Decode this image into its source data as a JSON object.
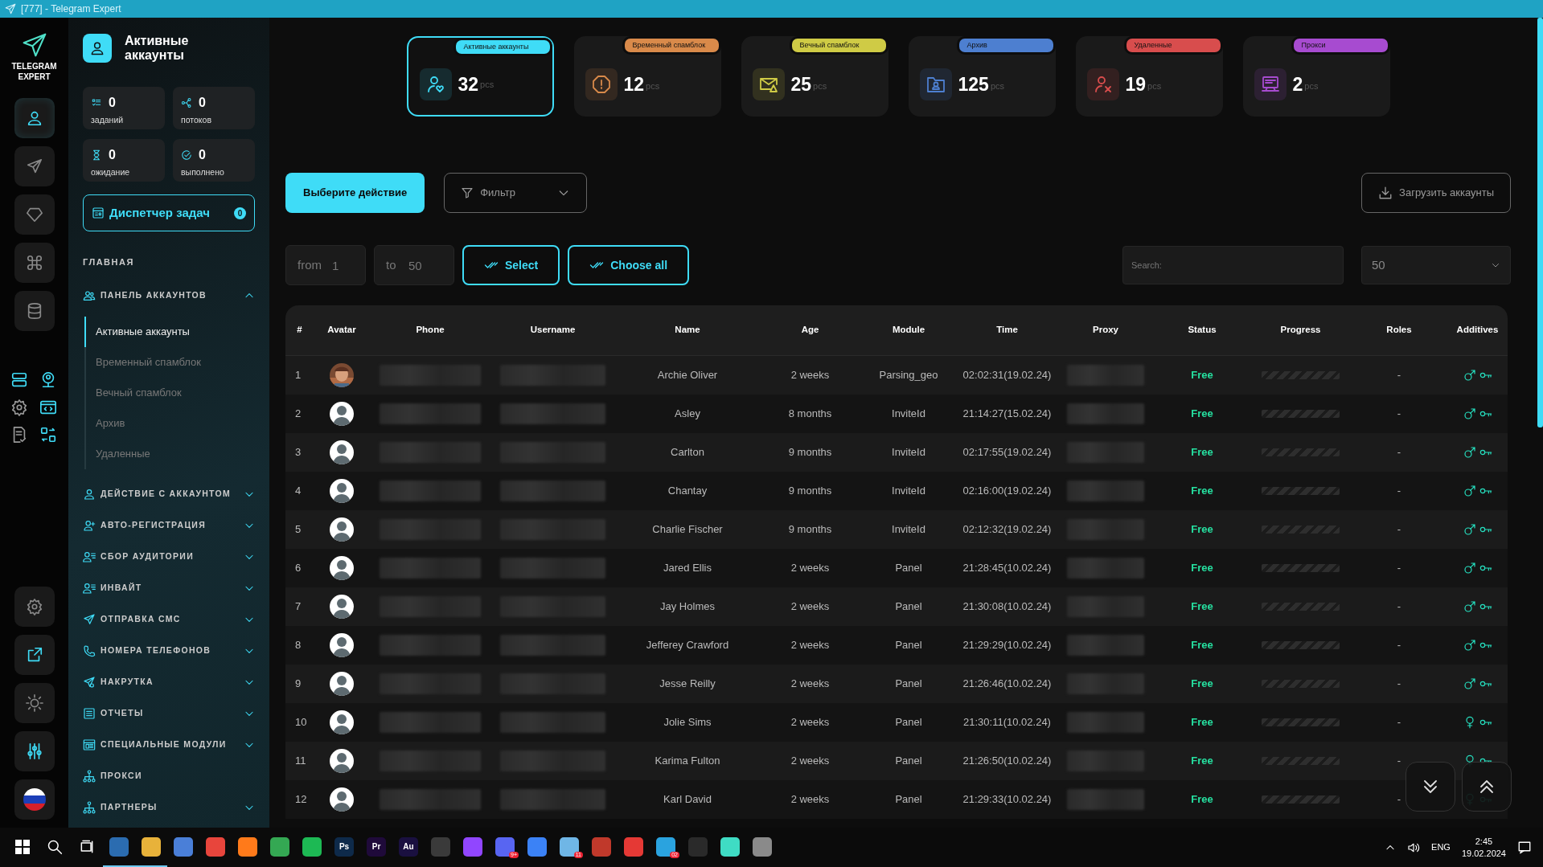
{
  "window": {
    "title": "[777] - Telegram Expert"
  },
  "brand": {
    "name": "TELEGRAM EXPERT"
  },
  "rail": {
    "top": [
      {
        "selected": true
      },
      {
        "selected": false
      },
      {
        "selected": false
      },
      {
        "selected": false
      },
      {
        "selected": false
      }
    ]
  },
  "sidebar": {
    "title": "Активные аккаунты",
    "stats": [
      {
        "value": "0",
        "label": "заданий"
      },
      {
        "value": "0",
        "label": "потоков"
      },
      {
        "value": "0",
        "label": "ожидание"
      },
      {
        "value": "0",
        "label": "выполнено"
      }
    ],
    "task_manager": {
      "label": "Диспетчер задач",
      "count": "0"
    },
    "section": "ГЛАВНАЯ",
    "groups": [
      {
        "label": "ПАНЕЛЬ АККАУНТОВ",
        "expandable": true,
        "expanded": true,
        "children": [
          {
            "label": "Активные аккаунты",
            "selected": true
          },
          {
            "label": "Временный спамблок",
            "selected": false
          },
          {
            "label": "Вечный спамблок",
            "selected": false
          },
          {
            "label": "Архив",
            "selected": false
          },
          {
            "label": "Удаленные",
            "selected": false
          }
        ]
      },
      {
        "label": "ДЕЙСТВИЕ С АККАУНТОМ",
        "expandable": true,
        "expanded": false
      },
      {
        "label": "АВТО-РЕГИСТРАЦИЯ",
        "expandable": true,
        "expanded": false
      },
      {
        "label": "СБОР АУДИТОРИИ",
        "expandable": true,
        "expanded": false
      },
      {
        "label": "ИНВАЙТ",
        "expandable": true,
        "expanded": false
      },
      {
        "label": "ОТПРАВКА СМС",
        "expandable": true,
        "expanded": false
      },
      {
        "label": "НОМЕРА ТЕЛЕФОНОВ",
        "expandable": true,
        "expanded": false
      },
      {
        "label": "НАКРУТКА",
        "expandable": true,
        "expanded": false
      },
      {
        "label": "ОТЧЕТЫ",
        "expandable": true,
        "expanded": false
      },
      {
        "label": "СПЕЦИАЛЬНЫЕ МОДУЛИ",
        "expandable": true,
        "expanded": false
      },
      {
        "label": "ПРОКСИ",
        "expandable": false,
        "expanded": false
      },
      {
        "label": "ПАРТНЕРЫ",
        "expandable": true,
        "expanded": false
      }
    ]
  },
  "cards": [
    {
      "label": "Активные аккаунты",
      "value": "32",
      "unit": "pcs",
      "color": "#3fdcf7",
      "selected": true
    },
    {
      "label": "Временный спамблок",
      "value": "12",
      "unit": "pcs",
      "color": "#d98a4a",
      "selected": false
    },
    {
      "label": "Вечный спамблок",
      "value": "25",
      "unit": "pcs",
      "color": "#cfcb45",
      "selected": false
    },
    {
      "label": "Архив",
      "value": "125",
      "unit": "pcs",
      "color": "#4d7fd0",
      "selected": false
    },
    {
      "label": "Удаленные",
      "value": "19",
      "unit": "pcs",
      "color": "#d84d4d",
      "selected": false
    },
    {
      "label": "Прокси",
      "value": "2",
      "unit": "pcs",
      "color": "#a74bd0",
      "selected": false
    }
  ],
  "toolbar": {
    "action": "Выберите действие",
    "filter": "Фильтр",
    "upload": "Загрузить аккаунты"
  },
  "range": {
    "from_label": "from",
    "from_value": "1",
    "to_label": "to",
    "to_value": "50",
    "select": "Select",
    "choose_all": "Choose all"
  },
  "search": {
    "placeholder": "Search:"
  },
  "page_size": {
    "value": "50"
  },
  "table": {
    "columns": [
      "#",
      "Avatar",
      "Phone",
      "Username",
      "Name",
      "Age",
      "Module",
      "Time",
      "Proxy",
      "Status",
      "Progress",
      "Roles",
      "Additives"
    ],
    "rows": [
      {
        "n": "1",
        "name": "Archie Oliver",
        "age": "2 weeks",
        "module": "Parsing_geo",
        "time": "02:02:31(19.02.24)",
        "status": "Free",
        "roles": "-",
        "gender": {
          "kind": "male"
        }
      },
      {
        "n": "2",
        "avatar": {
          "kind": "default"
        },
        "name": "Asley",
        "age": "8 months",
        "module": "InviteId",
        "time": "21:14:27(15.02.24)",
        "status": "Free",
        "roles": "-",
        "gender": {
          "kind": "male"
        }
      },
      {
        "n": "3",
        "avatar": {
          "kind": "default"
        },
        "name": "Carlton",
        "age": "9 months",
        "module": "InviteId",
        "time": "02:17:55(19.02.24)",
        "status": "Free",
        "roles": "-",
        "gender": {
          "kind": "male"
        }
      },
      {
        "n": "4",
        "avatar": {
          "kind": "default"
        },
        "name": "Chantay",
        "age": "9 months",
        "module": "InviteId",
        "time": "02:16:00(19.02.24)",
        "status": "Free",
        "roles": "-",
        "gender": {
          "kind": "male"
        }
      },
      {
        "n": "5",
        "avatar": {
          "kind": "default"
        },
        "name": "Charlie Fischer",
        "age": "9 months",
        "module": "InviteId",
        "time": "02:12:32(19.02.24)",
        "status": "Free",
        "roles": "-",
        "gender": {
          "kind": "male"
        }
      },
      {
        "n": "6",
        "avatar": {
          "kind": "default"
        },
        "name": "Jared Ellis",
        "age": "2 weeks",
        "module": "Panel",
        "time": "21:28:45(10.02.24)",
        "status": "Free",
        "roles": "-",
        "gender": {
          "kind": "male"
        }
      },
      {
        "n": "7",
        "avatar": {
          "kind": "default"
        },
        "name": "Jay Holmes",
        "age": "2 weeks",
        "module": "Panel",
        "time": "21:30:08(10.02.24)",
        "status": "Free",
        "roles": "-",
        "gender": {
          "kind": "male"
        }
      },
      {
        "n": "8",
        "avatar": {
          "kind": "default"
        },
        "name": "Jefferey Crawford",
        "age": "2 weeks",
        "module": "Panel",
        "time": "21:29:29(10.02.24)",
        "status": "Free",
        "roles": "-",
        "gender": {
          "kind": "male"
        }
      },
      {
        "n": "9",
        "avatar": {
          "kind": "default"
        },
        "name": "Jesse Reilly",
        "age": "2 weeks",
        "module": "Panel",
        "time": "21:26:46(10.02.24)",
        "status": "Free",
        "roles": "-",
        "gender": {
          "kind": "male"
        }
      },
      {
        "n": "10",
        "avatar": {
          "kind": "default"
        },
        "name": "Jolie Sims",
        "age": "2 weeks",
        "module": "Panel",
        "time": "21:30:11(10.02.24)",
        "status": "Free",
        "roles": "-",
        "gender": {
          "kind": "female"
        }
      },
      {
        "n": "11",
        "avatar": {
          "kind": "default"
        },
        "name": "Karima Fulton",
        "age": "2 weeks",
        "module": "Panel",
        "time": "21:26:50(10.02.24)",
        "status": "Free",
        "roles": "-",
        "gender": {
          "kind": "female"
        }
      },
      {
        "n": "12",
        "avatar": {
          "kind": "default"
        },
        "name": "Karl David",
        "age": "2 weeks",
        "module": "Panel",
        "time": "21:29:33(10.02.24)",
        "status": "Free",
        "roles": "-",
        "gender": {
          "kind": "female"
        }
      }
    ]
  },
  "taskbar": {
    "apps": [
      {
        "color": "#2b6cb0",
        "active": true
      },
      {
        "color": "#e8b23a",
        "active": true
      },
      {
        "color": "#4a7fd8",
        "active": false
      },
      {
        "color": "#e8453c",
        "active": false
      },
      {
        "color": "#ff7a1a",
        "active": false
      },
      {
        "color": "#34a853",
        "active": false
      },
      {
        "color": "#1db954",
        "active": false
      },
      {
        "color": "#0e2a4a",
        "label": "Ps",
        "active": false
      },
      {
        "color": "#1f0a3a",
        "label": "Pr",
        "active": false
      },
      {
        "color": "#1a1040",
        "label": "Au",
        "active": false
      },
      {
        "color": "#3a3a3a",
        "active": false
      },
      {
        "color": "#9146ff",
        "active": false
      },
      {
        "color": "#5865f2",
        "badge": "9+",
        "active": false
      },
      {
        "color": "#3b82f6",
        "active": false
      },
      {
        "color": "#6fb6e6",
        "badge": "11",
        "active": false
      },
      {
        "color": "#c0392b",
        "active": false
      },
      {
        "color": "#e53935",
        "active": false
      },
      {
        "color": "#2aa3df",
        "badge": "02",
        "active": false
      },
      {
        "color": "#2a2a2a",
        "active": false
      },
      {
        "color": "#3fdcc4",
        "active": false
      },
      {
        "color": "#8a8a8a",
        "active": false
      }
    ],
    "language": "ENG",
    "time": "2:45",
    "date": "19.02.2024"
  }
}
